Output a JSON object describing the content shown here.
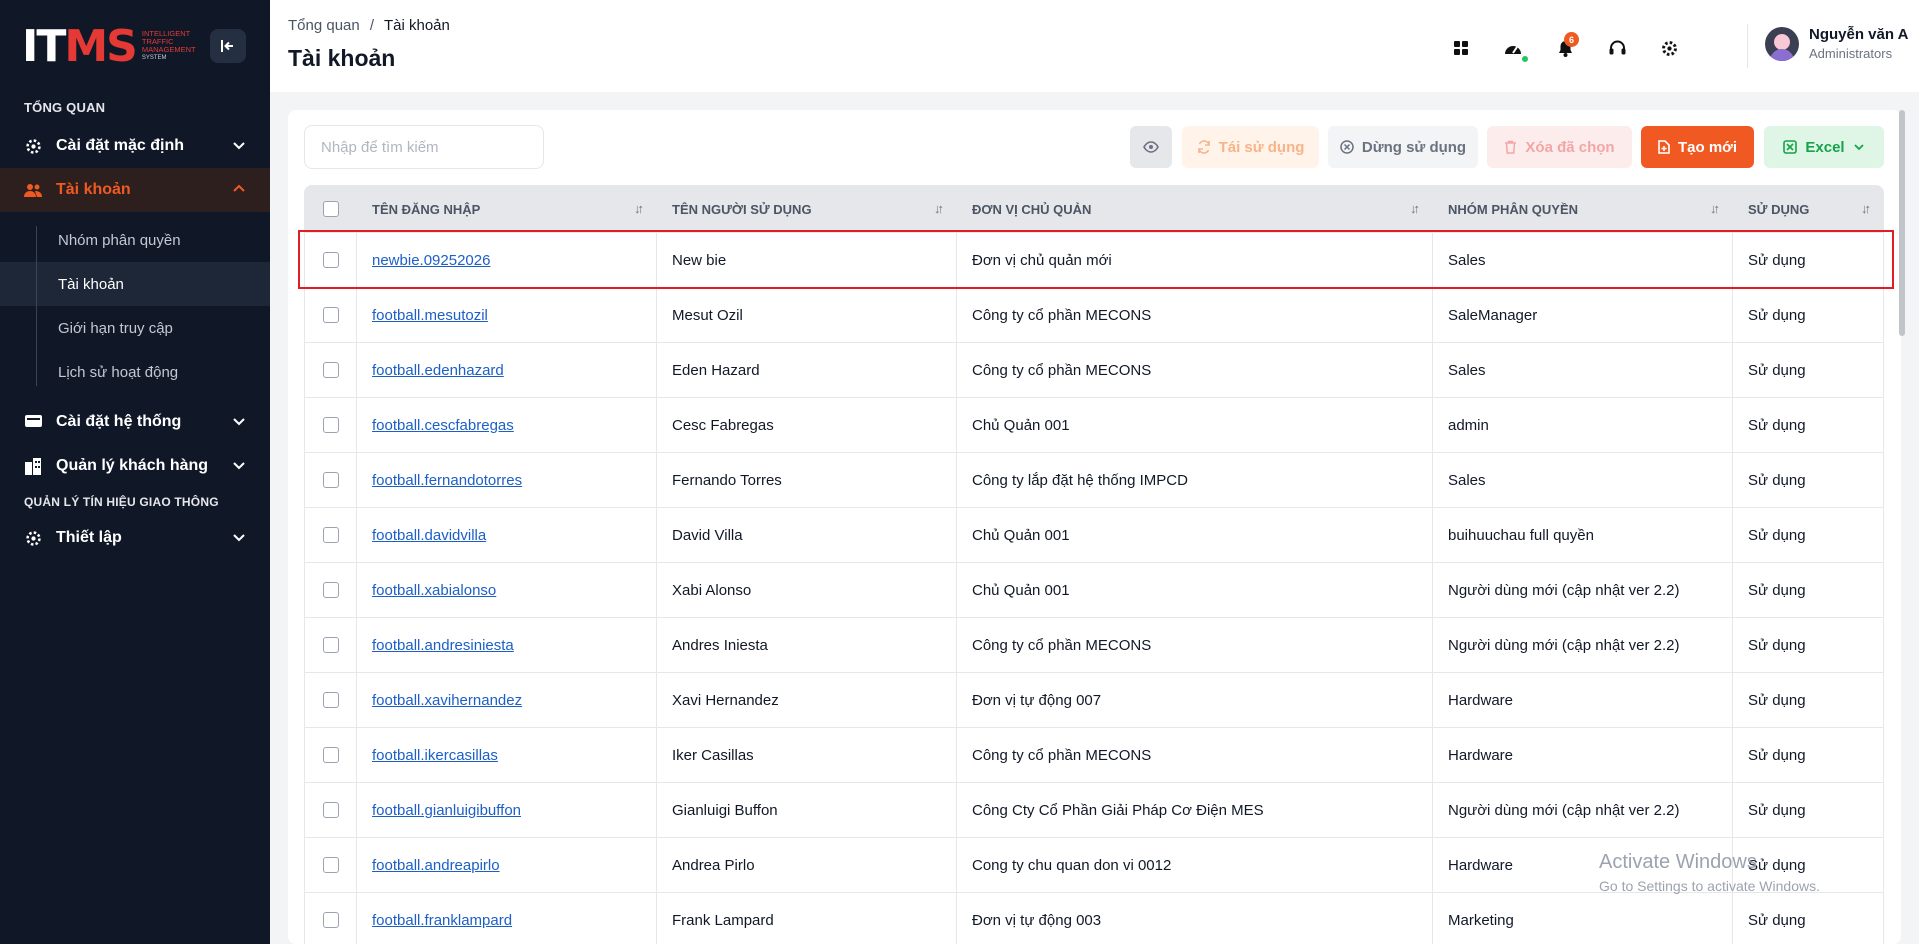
{
  "sidebar": {
    "collapse_icon": "collapse-left-icon",
    "logo": {
      "mark": "IT",
      "mark_s": "MS",
      "line1": "INTELLIGENT",
      "line2": "TRAFFIC",
      "line3": "MANAGEMENT",
      "line4": "SYSTEM"
    },
    "section1": "TỔNG QUAN",
    "item_default": "Cài đặt mặc định",
    "item_account": "Tài khoản",
    "sub": [
      "Nhóm phân quyền",
      "Tài khoản",
      "Giới hạn truy cập",
      "Lịch sử hoạt động"
    ],
    "item_system": "Cài đặt hệ thống",
    "item_customer": "Quản lý khách hàng",
    "section2": "QUẢN LÝ TÍN HIỆU GIAO THÔNG",
    "item_setup": "Thiết lập"
  },
  "header": {
    "breadcrumb_root": "Tổng quan",
    "breadcrumb_sep": "/",
    "breadcrumb_current": "Tài khoản",
    "title": "Tài khoản",
    "notification_count": "6",
    "user_name": "Nguyễn văn A",
    "user_role": "Administrators"
  },
  "toolbar": {
    "search_placeholder": "Nhập để tìm kiếm",
    "reuse": "Tái sử dụng",
    "stop": "Dừng sử dụng",
    "delete": "Xóa đã chọn",
    "create": "Tạo mới",
    "excel": "Excel"
  },
  "table": {
    "columns": [
      "TÊN ĐĂNG NHẬP",
      "TÊN NGƯỜI SỬ DỤNG",
      "ĐƠN VỊ CHỦ QUẢN",
      "NHÓM PHÂN QUYỀN",
      "SỬ DỤNG"
    ],
    "rows": [
      {
        "username": "newbie.09252026",
        "name": "New bie",
        "unit": "Đơn vị chủ quản mới",
        "group": "Sales",
        "status": "Sử dụng"
      },
      {
        "username": "football.mesutozil",
        "name": "Mesut Ozil",
        "unit": "Công ty cổ phần MECONS",
        "group": "SaleManager",
        "status": "Sử dụng"
      },
      {
        "username": "football.edenhazard",
        "name": "Eden Hazard",
        "unit": "Công ty cổ phần MECONS",
        "group": "Sales",
        "status": "Sử dụng"
      },
      {
        "username": "football.cescfabregas",
        "name": "Cesc Fabregas",
        "unit": "Chủ Quản 001",
        "group": "admin",
        "status": "Sử dụng"
      },
      {
        "username": "football.fernandotorres",
        "name": "Fernando Torres",
        "unit": "Công ty lắp đặt hệ thống IMPCD",
        "group": "Sales",
        "status": "Sử dụng"
      },
      {
        "username": "football.davidvilla",
        "name": "David Villa",
        "unit": "Chủ Quản 001",
        "group": "buihuuchau full quyền",
        "status": "Sử dụng"
      },
      {
        "username": "football.xabialonso",
        "name": "Xabi Alonso",
        "unit": "Chủ Quản 001",
        "group": "Người dùng mới (cập nhật ver 2.2)",
        "status": "Sử dụng"
      },
      {
        "username": "football.andresiniesta",
        "name": "Andres Iniesta",
        "unit": "Công ty cổ phần MECONS",
        "group": "Người dùng mới (cập nhật ver 2.2)",
        "status": "Sử dụng"
      },
      {
        "username": "football.xavihernandez",
        "name": "Xavi Hernandez",
        "unit": "Đơn vị tự động 007",
        "group": "Hardware",
        "status": "Sử dụng"
      },
      {
        "username": "football.ikercasillas",
        "name": "Iker Casillas",
        "unit": "Công ty cổ phần MECONS",
        "group": "Hardware",
        "status": "Sử dụng"
      },
      {
        "username": "football.gianluigibuffon",
        "name": "Gianluigi Buffon",
        "unit": "Công Cty Cổ Phần Giải Pháp Cơ Điện MES",
        "group": "Người dùng mới (cập nhật ver 2.2)",
        "status": "Sử dụng"
      },
      {
        "username": "football.andreapirlo",
        "name": "Andrea Pirlo",
        "unit": "Cong ty chu quan don vi 0012",
        "group": "Hardware",
        "status": "Sử dụng"
      },
      {
        "username": "football.franklampard",
        "name": "Frank Lampard",
        "unit": "Đơn vị tự động 003",
        "group": "Marketing",
        "status": "Sử dụng"
      }
    ]
  },
  "watermark": {
    "title": "Activate Windows",
    "subtitle": "Go to Settings to activate Windows."
  },
  "colors": {
    "accent": "#f05a22",
    "sidebar": "#101828",
    "link": "#1d5fc8",
    "highlight": "#e11d24"
  }
}
